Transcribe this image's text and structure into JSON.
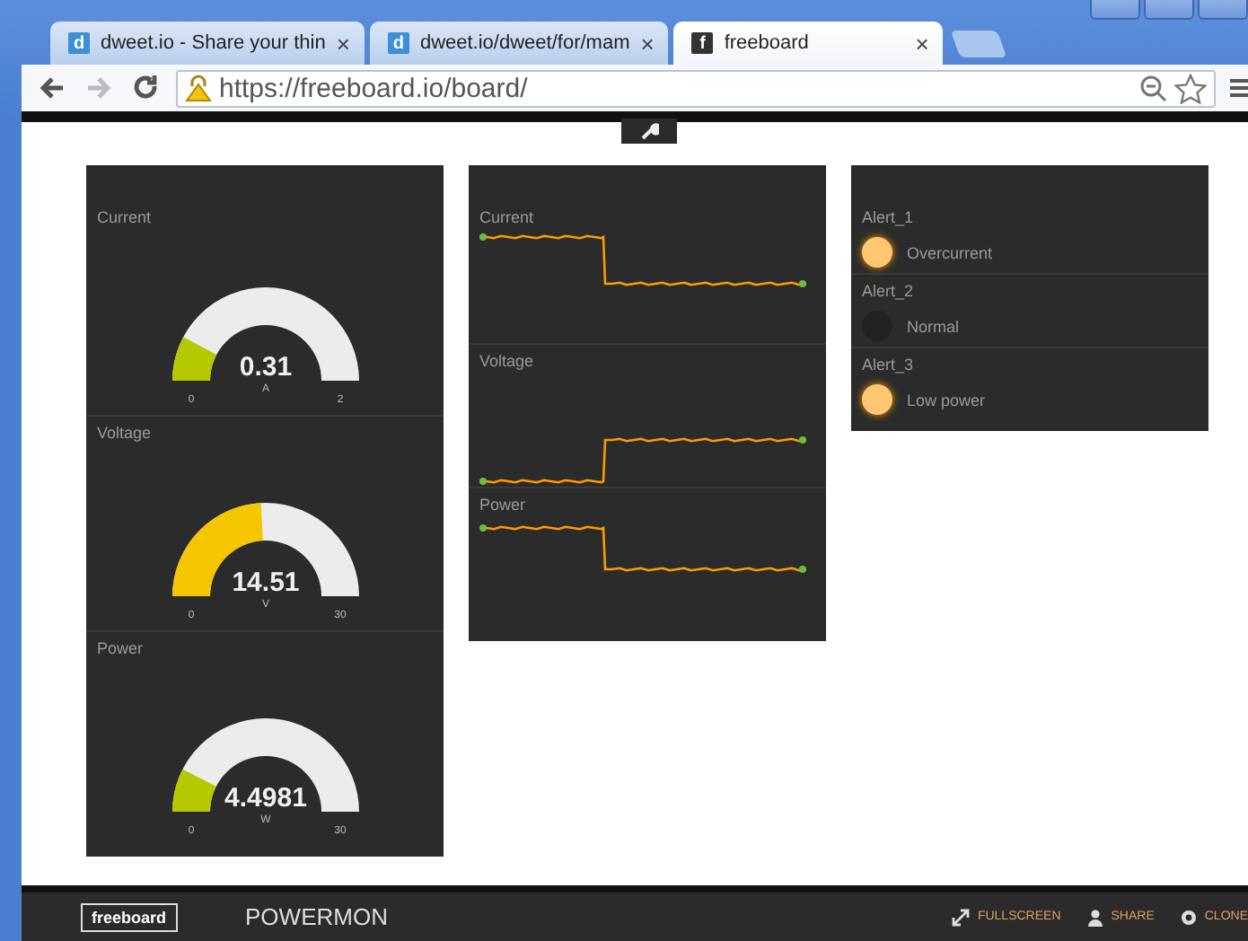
{
  "browser": {
    "tabs": [
      {
        "title": "dweet.io - Share your thin",
        "favicon": "d",
        "color": "#3d8fd6",
        "close": "×",
        "selected": false
      },
      {
        "title": "dweet.io/dweet/for/mam",
        "favicon": "d",
        "color": "#3d8fd6",
        "close": "×",
        "selected": false
      },
      {
        "title": "freeboard",
        "favicon": "f",
        "color": "#333333",
        "close": "×",
        "selected": true
      }
    ],
    "url": "https://freeboard.io/board/"
  },
  "gauges": [
    {
      "title": "Current",
      "value": "0.31",
      "unit": "A",
      "min": "0",
      "max": "2",
      "color": "#b5c800"
    },
    {
      "title": "Voltage",
      "value": "14.51",
      "unit": "V",
      "min": "0",
      "max": "30",
      "color": "#f5c500"
    },
    {
      "title": "Power",
      "value": "4.4981",
      "unit": "W",
      "min": "0",
      "max": "30",
      "color": "#b5c800"
    }
  ],
  "sparklines": [
    {
      "title": "Current",
      "kind": "step_down"
    },
    {
      "title": "Voltage",
      "kind": "step_up"
    },
    {
      "title": "Power",
      "kind": "step_down"
    }
  ],
  "indicators": [
    {
      "title": "Alert_1",
      "text": "Overcurrent",
      "on": true
    },
    {
      "title": "Alert_2",
      "text": "Normal",
      "on": false
    },
    {
      "title": "Alert_3",
      "text": "Low power",
      "on": true
    }
  ],
  "footer": {
    "logo": "freeboard",
    "title": "POWERMON",
    "actions": [
      {
        "label": "FULLSCREEN",
        "kind": "fullscreen"
      },
      {
        "label": "SHARE",
        "kind": "share"
      },
      {
        "label": "CLONE",
        "kind": "clone"
      }
    ]
  }
}
